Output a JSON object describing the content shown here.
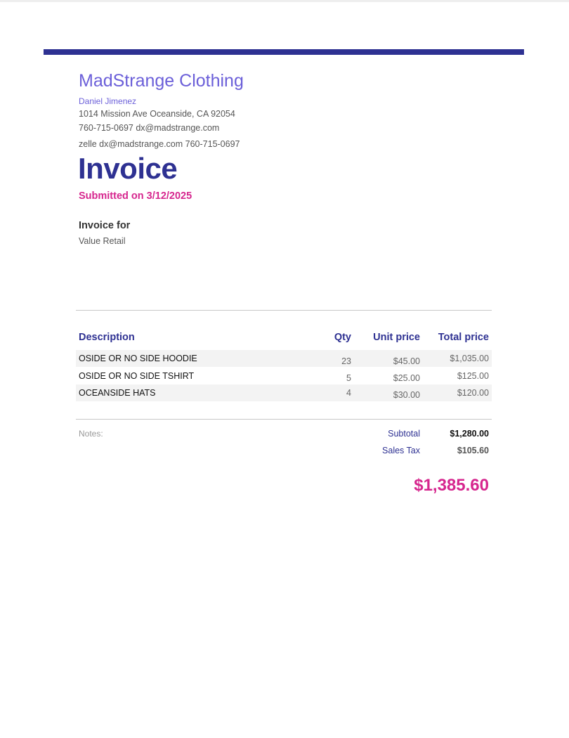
{
  "colors": {
    "accent_navy": "#2e3192",
    "accent_purple": "#6b5fd9",
    "accent_magenta": "#d6268e",
    "row_shade": "#f3f3f3"
  },
  "company": {
    "name": "MadStrange Clothing",
    "contact_name": "Daniel Jimenez",
    "address": "1014 Mission Ave Oceanside, CA 92054",
    "phone_email": "760-715-0697 dx@madstrange.com",
    "payment_line": "zelle dx@madstrange.com 760-715-0697"
  },
  "invoice": {
    "title": "Invoice",
    "submitted": "Submitted on 3/12/2025"
  },
  "bill_to": {
    "label": "Invoice for",
    "value": "Value Retail"
  },
  "table": {
    "headers": {
      "description": "Description",
      "qty": "Qty",
      "unit_price": "Unit price",
      "total_price": "Total price"
    },
    "rows": [
      {
        "description": "OSIDE OR NO SIDE HOODIE",
        "qty": "23",
        "unit_price": "$45.00",
        "total_price": "$1,035.00"
      },
      {
        "description": "OSIDE OR NO SIDE TSHIRT",
        "qty": "5",
        "unit_price": "$25.00",
        "total_price": "$125.00"
      },
      {
        "description": "OCEANSIDE HATS",
        "qty": "4",
        "unit_price": "$30.00",
        "total_price": "$120.00"
      }
    ]
  },
  "summary": {
    "notes_label": "Notes:",
    "subtotal_label": "Subtotal",
    "subtotal_value": "$1,280.00",
    "tax_label": "Sales Tax",
    "tax_value": "$105.60",
    "total_value": "$1,385.60"
  }
}
